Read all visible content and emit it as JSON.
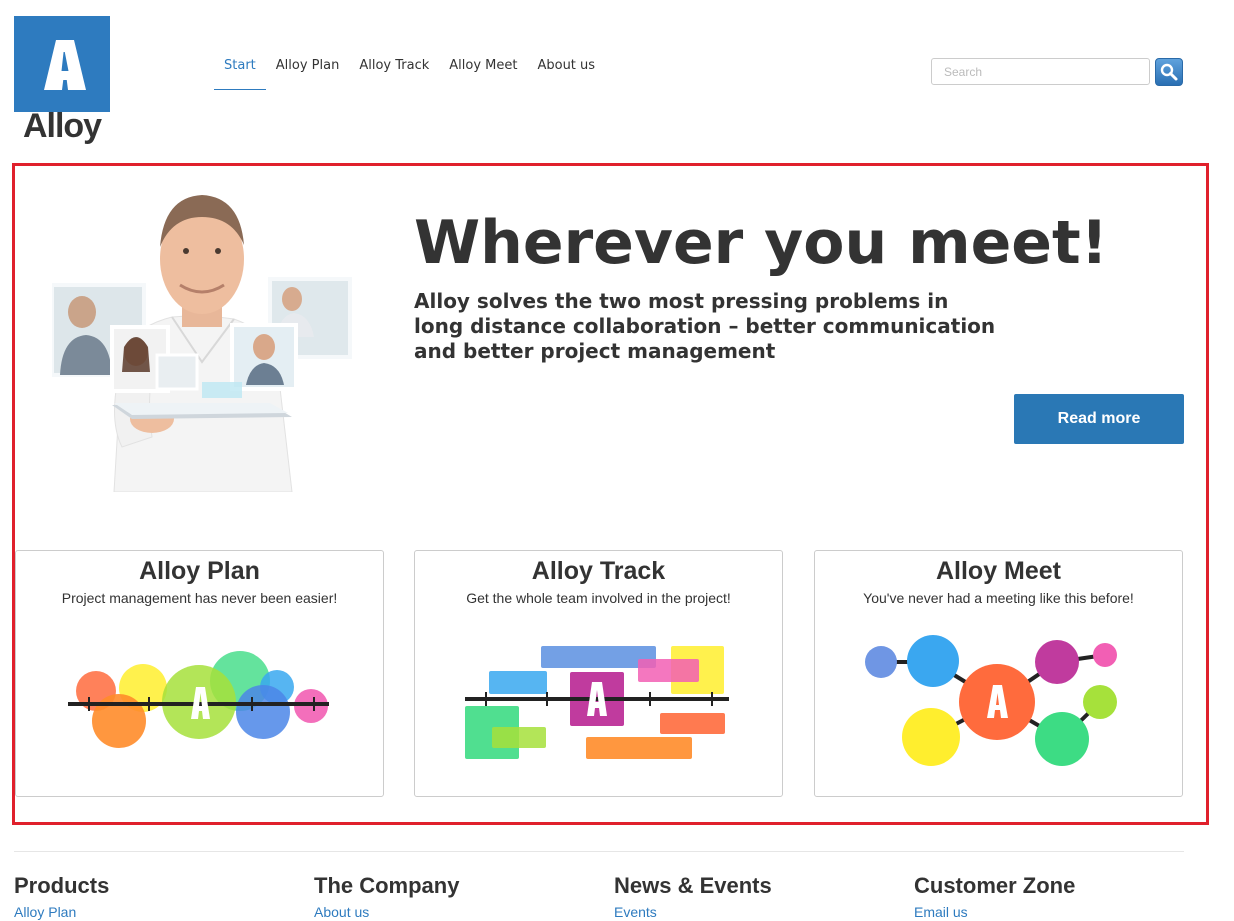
{
  "logo": {
    "letter": "A",
    "wordmark": "Alloy",
    "color": "#2e7bbf"
  },
  "nav": {
    "items": [
      {
        "label": "Start",
        "active": true
      },
      {
        "label": "Alloy Plan"
      },
      {
        "label": "Alloy Track"
      },
      {
        "label": "Alloy Meet"
      },
      {
        "label": "About us"
      }
    ]
  },
  "search": {
    "placeholder": "Search",
    "value": "",
    "button_icon": "search-icon"
  },
  "hero": {
    "title": "Wherever you meet!",
    "subtitle": "Alloy solves the two most pressing problems in long distance collaboration – better communication and better project management",
    "cta_label": "Read more",
    "cta_color": "#2a78b5",
    "image": "man-holding-tablet-with-video-call-photos"
  },
  "cards": [
    {
      "title": "Alloy Plan",
      "description": "Project management has never been easier!",
      "illustration": "colorful-circles-timeline"
    },
    {
      "title": "Alloy Track",
      "description": "Get the whole team involved in the project!",
      "illustration": "colorful-blocks-timeline"
    },
    {
      "title": "Alloy Meet",
      "description": "You've never had a meeting like this before!",
      "illustration": "connected-circles-network"
    }
  ],
  "footer": {
    "columns": [
      {
        "heading": "Products",
        "link": "Alloy Plan"
      },
      {
        "heading": "The Company",
        "link": "About us"
      },
      {
        "heading": "News & Events",
        "link": "Events"
      },
      {
        "heading": "Customer Zone",
        "link": "Email us"
      }
    ]
  },
  "highlight_color": "#e0202c"
}
